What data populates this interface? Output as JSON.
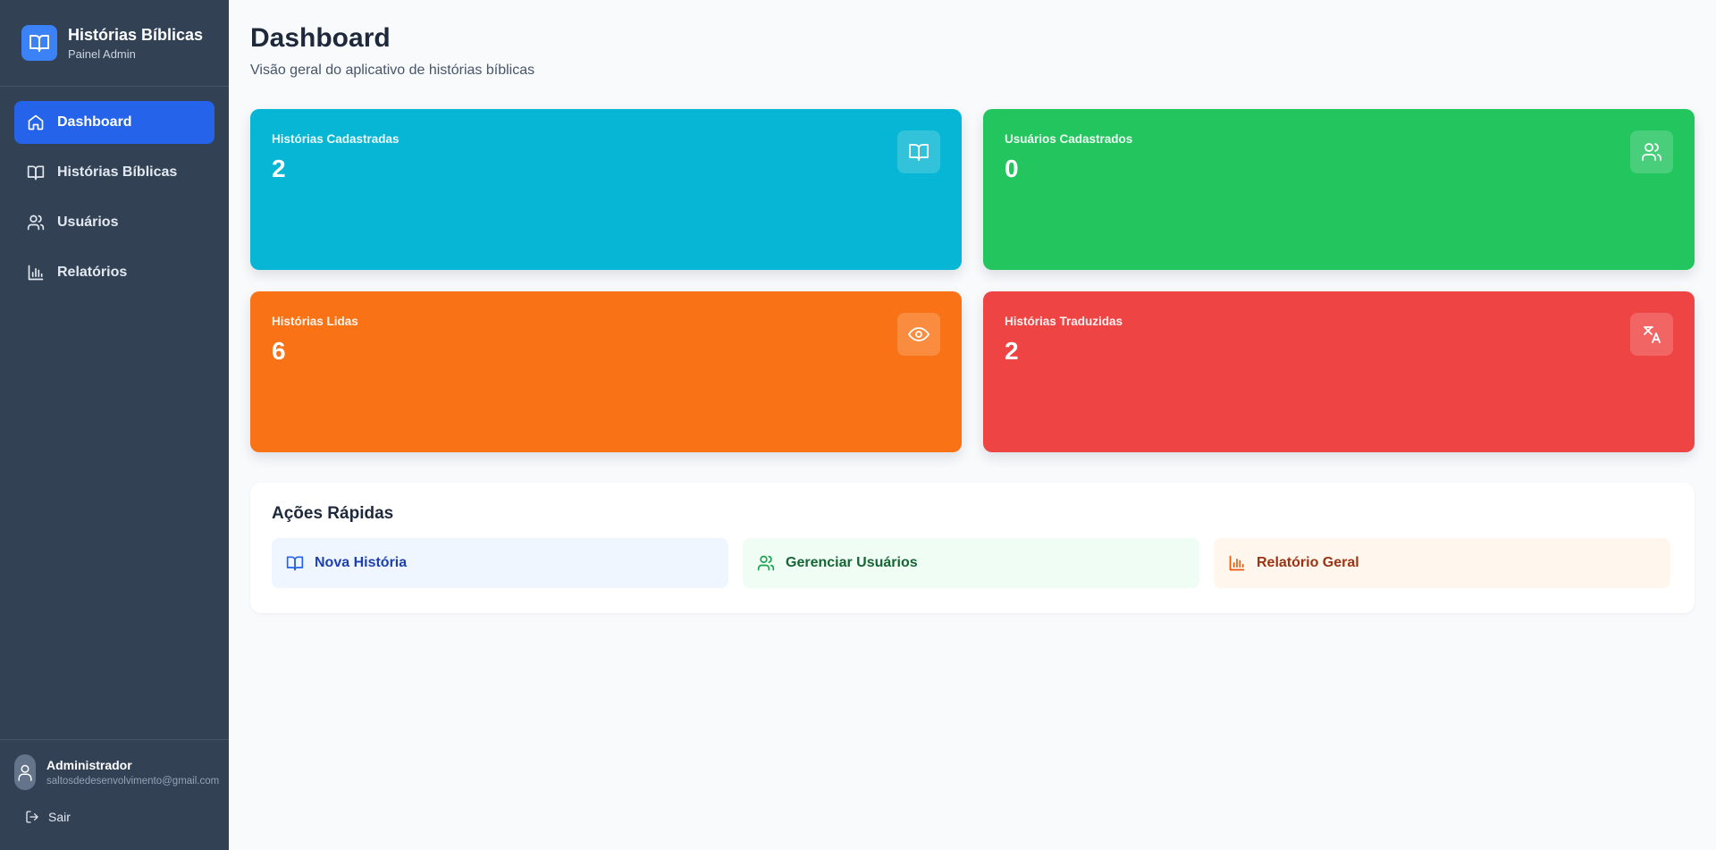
{
  "brand": {
    "title": "Histórias Bíblicas",
    "subtitle": "Painel Admin",
    "logo_icon": "book-open-icon"
  },
  "nav": {
    "items": [
      {
        "label": "Dashboard",
        "icon": "home-icon",
        "active": true
      },
      {
        "label": "Histórias Bíblicas",
        "icon": "book-open-icon",
        "active": false
      },
      {
        "label": "Usuários",
        "icon": "users-icon",
        "active": false
      },
      {
        "label": "Relatórios",
        "icon": "bar-chart-icon",
        "active": false
      }
    ]
  },
  "user": {
    "name": "Administrador",
    "email": "saltosdedesenvolvimento@gmail.com",
    "logout_label": "Sair"
  },
  "header": {
    "title": "Dashboard",
    "subtitle": "Visão geral do aplicativo de histórias bíblicas"
  },
  "stats": [
    {
      "label": "Histórias Cadastradas",
      "value": "2",
      "icon": "book-open-icon",
      "color": "#06b6d4"
    },
    {
      "label": "Usuários Cadastrados",
      "value": "0",
      "icon": "users-icon",
      "color": "#22c55e"
    },
    {
      "label": "Histórias Lidas",
      "value": "6",
      "icon": "eye-icon",
      "color": "#f97316"
    },
    {
      "label": "Histórias Traduzidas",
      "value": "2",
      "icon": "languages-icon",
      "color": "#ef4444"
    }
  ],
  "quick_actions": {
    "title": "Ações Rápidas",
    "items": [
      {
        "label": "Nova História",
        "icon": "book-open-icon",
        "color": "#1e40af"
      },
      {
        "label": "Gerenciar Usuários",
        "icon": "users-icon",
        "color": "#166534"
      },
      {
        "label": "Relatório Geral",
        "icon": "bar-chart-icon",
        "color": "#9a3412"
      }
    ]
  },
  "colors": {
    "sidebar": "#334155",
    "active_nav": "#2563eb",
    "background": "#f8fafc"
  }
}
